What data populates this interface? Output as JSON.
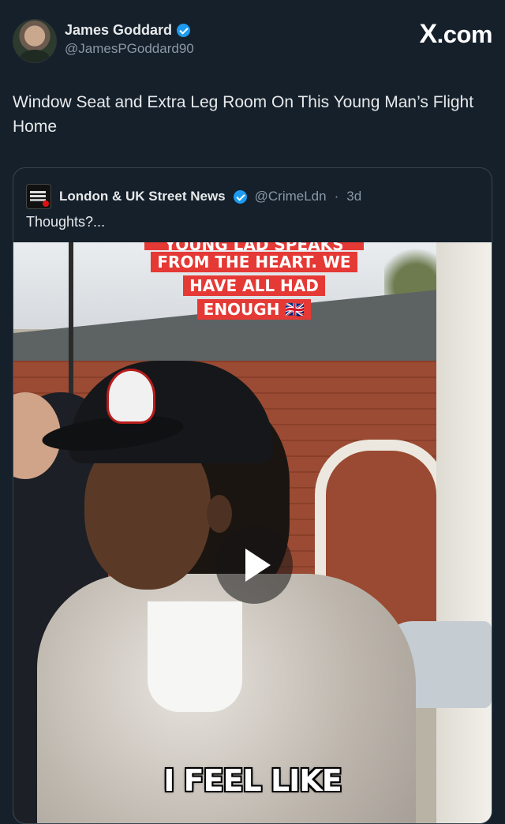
{
  "author": {
    "display_name": "James Goddard",
    "handle": "@JamesPGoddard90",
    "verified": true
  },
  "brand": {
    "x": "X",
    "rest": ".com"
  },
  "tweet": {
    "text": "Window Seat and Extra Leg Room On This Young Man’s Flight Home"
  },
  "quote": {
    "display_name": "London & UK Street News",
    "handle": "@CrimeLdn",
    "separator": "·",
    "age": "3d",
    "verified": true,
    "text": "Thoughts?...",
    "video": {
      "caption_cut": "YOUNG LAD SPEAKS",
      "caption_lines": [
        "FROM THE HEART. WE",
        "HAVE ALL HAD",
        "ENOUGH 🇬🇧"
      ],
      "subtitle": "I FEEL LIKE",
      "play_icon": "play-icon"
    }
  },
  "colors": {
    "background": "#15202b",
    "accent": "#1d9bf0",
    "caption_red": "#e53935",
    "muted": "#8b98a5"
  }
}
